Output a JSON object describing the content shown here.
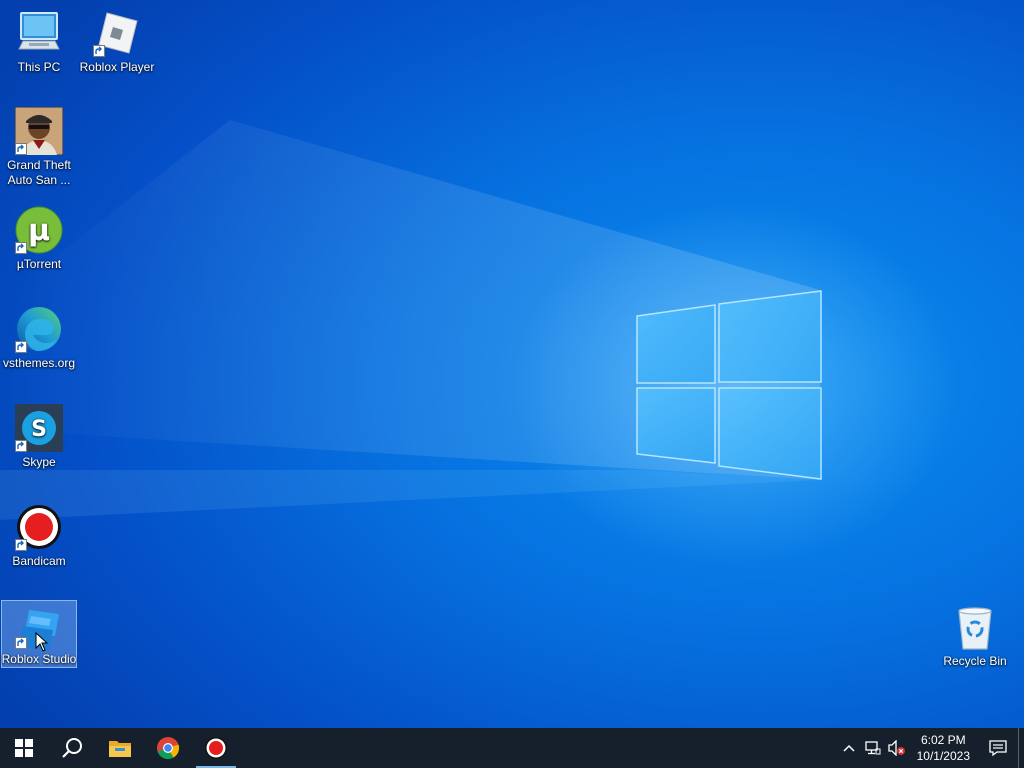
{
  "desktop": {
    "icons": [
      {
        "label": "This PC",
        "icon": "this-pc-icon"
      },
      {
        "label": "Roblox Player",
        "icon": "roblox-player-icon"
      },
      {
        "label": "Grand Theft Auto San ...",
        "icon": "gta-san-andreas-icon"
      },
      {
        "label": "µTorrent",
        "icon": "utorrent-icon"
      },
      {
        "label": "vsthemes.org",
        "icon": "edge-icon"
      },
      {
        "label": "Skype",
        "icon": "skype-icon"
      },
      {
        "label": "Bandicam",
        "icon": "bandicam-icon"
      },
      {
        "label": "Roblox Studio",
        "icon": "roblox-studio-icon",
        "selected": true
      },
      {
        "label": "Recycle Bin",
        "icon": "recycle-bin-icon"
      }
    ]
  },
  "taskbar": {
    "pinned": [
      {
        "name": "Start",
        "icon": "windows-start-icon"
      },
      {
        "name": "Search",
        "icon": "search-icon"
      },
      {
        "name": "File Explorer",
        "icon": "file-explorer-icon"
      },
      {
        "name": "Google Chrome",
        "icon": "chrome-icon"
      },
      {
        "name": "Bandicam",
        "icon": "bandicam-icon",
        "running": true
      }
    ],
    "tray": {
      "icons": [
        "chevron-up-icon",
        "network-icon",
        "volume-muted-icon"
      ],
      "time": "6:02 PM",
      "date": "10/1/2023",
      "notification_icon": "action-center-icon"
    }
  },
  "colors": {
    "taskbar_bg": "#16202c",
    "desktop_blue": "#0672e0",
    "accent": "#76b9ed"
  }
}
